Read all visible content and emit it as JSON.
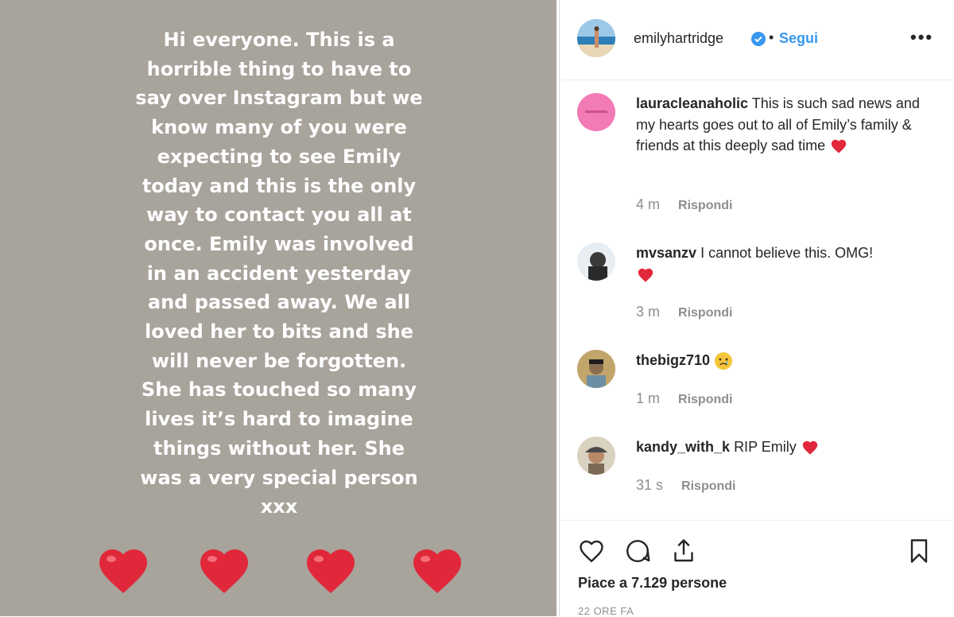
{
  "story": {
    "text": "Hi everyone. This is a\nhorrible thing to have to\nsay over Instagram but we\nknow many of you were\nexpecting to see Emily\ntoday and this is the only\nway to contact you all at\nonce. Emily was involved\nin an accident yesterday\nand passed away. We all\nloved her to bits and she\nwill never be forgotten.\nShe has touched so many\nlives it’s hard to imagine\nthings without her. She\nwas a very special person\nxxx",
    "hearts_icon": "red-heart-emoji"
  },
  "header": {
    "username": "emilyhartridge",
    "dot": "•",
    "follow_label": "Segui",
    "more_label": "•••"
  },
  "comments": [
    {
      "username": "lauracleanaholic",
      "text": "This is such sad news and my hearts goes out to all of Emily’s family & friends at this deeply sad time",
      "emoji": "heart",
      "time": "4 m",
      "reply": "Rispondi"
    },
    {
      "username": "mvsanzv",
      "text": "I cannot believe this. OMG!",
      "emoji": "heart",
      "time": "3 m",
      "reply": "Rispondi"
    },
    {
      "username": "thebigz710",
      "text": "",
      "emoji": "sad-face",
      "time": "1 m",
      "reply": "Rispondi"
    },
    {
      "username": "kandy_with_k",
      "text": "RIP Emily",
      "emoji": "heart",
      "time": "31 s",
      "reply": "Rispondi"
    }
  ],
  "actions": {
    "likes_prefix": "Piace a ",
    "likes_count": "7.129",
    "likes_suffix": " persone",
    "timestamp": "22 ORE FA"
  },
  "colors": {
    "story_bg": "#a8a39b",
    "link_blue": "#3897f0",
    "heart_red": "#e0283a"
  }
}
